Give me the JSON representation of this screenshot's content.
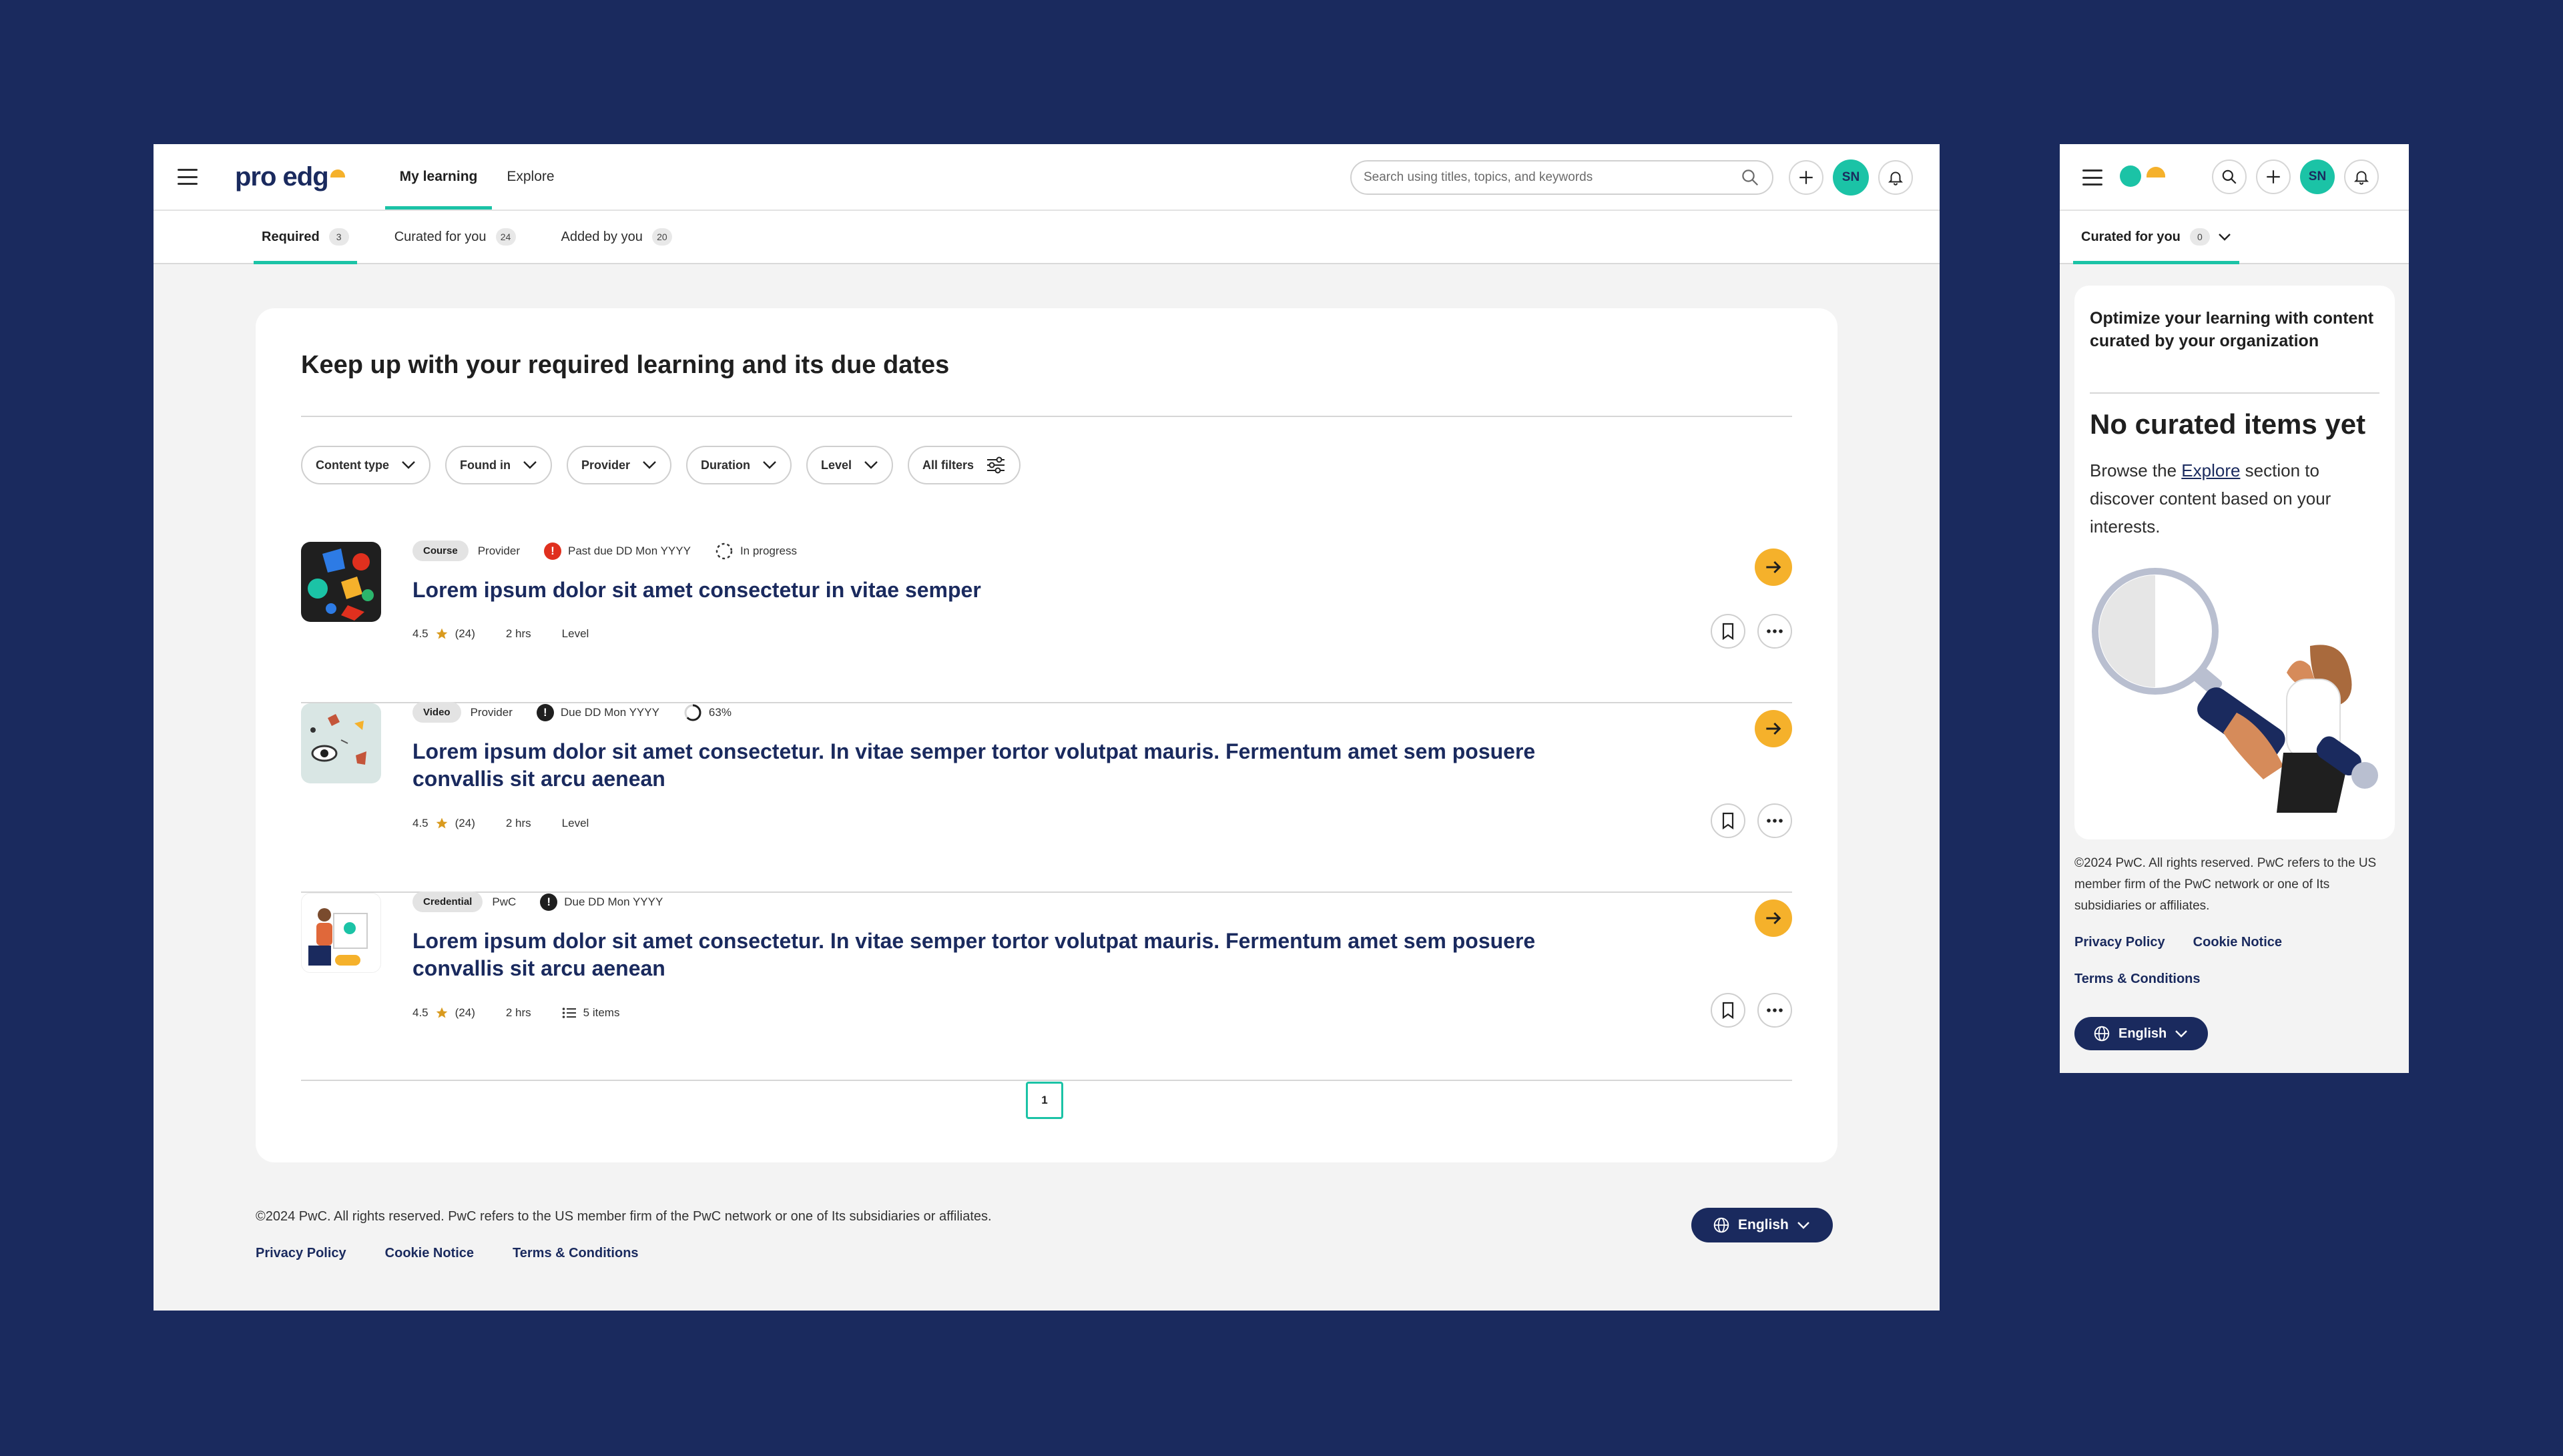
{
  "desktop": {
    "logo": {
      "text": "pro edg"
    },
    "nav": {
      "my_learning": "My learning",
      "explore": "Explore"
    },
    "search": {
      "placeholder": "Search using titles, topics, and keywords"
    },
    "avatar_initials": "SN",
    "subtabs": [
      {
        "label": "Required",
        "count": "3"
      },
      {
        "label": "Curated for you",
        "count": "24"
      },
      {
        "label": "Added by you",
        "count": "20"
      }
    ],
    "card_title": "Keep up with your required learning and its due dates",
    "filters": [
      "Content type",
      "Found in",
      "Provider",
      "Duration",
      "Level",
      "All filters"
    ],
    "items": [
      {
        "type": "Course",
        "provider": "Provider",
        "status": "Past due DD Mon YYYY",
        "progress": "In progress",
        "title": "Lorem ipsum dolor sit amet consectetur in vitae semper",
        "rating": "4.5",
        "reviews": "(24)",
        "duration": "2 hrs",
        "extra": "Level"
      },
      {
        "type": "Video",
        "provider": "Provider",
        "status": "Due DD Mon YYYY",
        "progress": "63%",
        "progress_value": 0.63,
        "title": "Lorem ipsum dolor sit amet consectetur. In vitae semper tortor volutpat mauris. Fermentum amet sem posuere convallis sit arcu aenean",
        "rating": "4.5",
        "reviews": "(24)",
        "duration": "2 hrs",
        "extra": "Level"
      },
      {
        "type": "Credential",
        "provider": "PwC",
        "status": "Due DD Mon YYYY",
        "title": "Lorem ipsum dolor sit amet consectetur. In vitae semper tortor volutpat mauris. Fermentum amet sem posuere convallis sit arcu aenean",
        "rating": "4.5",
        "reviews": "(24)",
        "duration": "2 hrs",
        "extra": "5 items"
      }
    ],
    "page": "1",
    "footer": {
      "copyright": "©2024 PwC. All rights reserved. PwC refers to the US member firm of the PwC network or one of Its subsidiaries or affiliates.",
      "links": [
        "Privacy Policy",
        "Cookie Notice",
        "Terms & Conditions"
      ],
      "language": "English"
    }
  },
  "mobile": {
    "avatar_initials": "SN",
    "subtab": {
      "label": "Curated for you",
      "count": "0"
    },
    "card_title": "Optimize your learning with content curated by your organization",
    "empty_title": "No curated items yet",
    "empty_body_pre": "Browse the ",
    "empty_body_link": "Explore",
    "empty_body_post": " section to discover content based on your interests.",
    "footer": {
      "copyright": "©2024 PwC. All rights reserved. PwC refers to the US member firm of the PwC network or one of Its subsidiaries or affiliates.",
      "links": [
        "Privacy Policy",
        "Cookie Notice",
        "Terms & Conditions"
      ],
      "language": "English"
    }
  },
  "colors": {
    "background": "#1a2a5e",
    "accent_teal": "#1bc3a6",
    "accent_yellow": "#f5b12b",
    "navy": "#1a2a5e",
    "past_due_red": "#e0301e"
  },
  "icons": [
    "menu-icon",
    "search-icon",
    "plus-icon",
    "bell-icon",
    "chevron-down-icon",
    "filter-sliders-icon",
    "alert-icon",
    "progress-icon",
    "star-icon",
    "arrow-right-icon",
    "bookmark-icon",
    "more-icon",
    "list-icon",
    "globe-icon"
  ]
}
